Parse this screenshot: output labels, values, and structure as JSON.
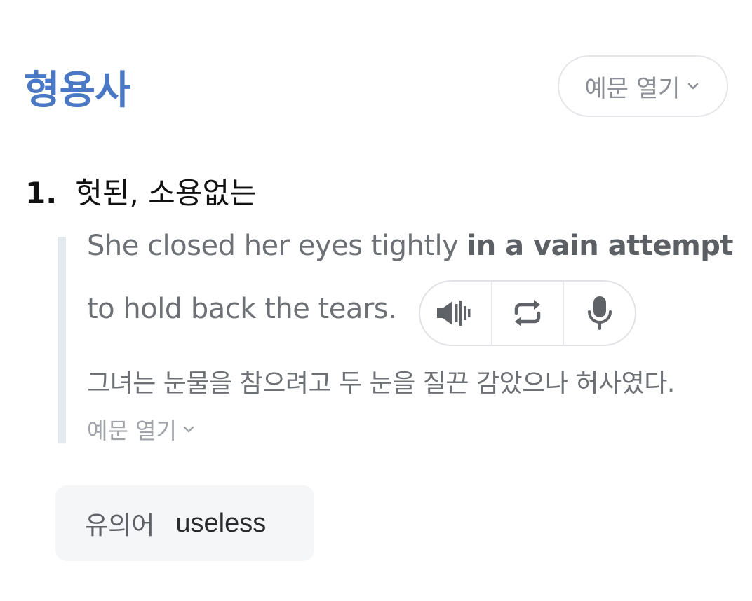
{
  "entry": {
    "part_of_speech": "형용사",
    "open_examples_label": "예문 열기",
    "senses": [
      {
        "number": "1.",
        "meaning": "헛된, 소용없는",
        "example": {
          "before": "She closed her eyes tightly ",
          "highlight": "in a vain attempt",
          "after": "to hold back the tears.",
          "translation": "그녀는 눈물을 참으려고 두 눈을 질끈 감았으나 허사였다."
        },
        "open_examples_label": "예문 열기"
      }
    ],
    "synonym": {
      "label": "유의어",
      "word": "useless"
    }
  },
  "icons": {
    "chevron": "chevron-down-icon",
    "speaker": "speaker-icon",
    "repeat": "repeat-icon",
    "mic": "microphone-icon"
  },
  "colors": {
    "accent": "#4a78c4",
    "text_muted": "#6d7075",
    "quote_bar": "#e4e8ef",
    "synonym_bg": "#f5f6f8"
  }
}
